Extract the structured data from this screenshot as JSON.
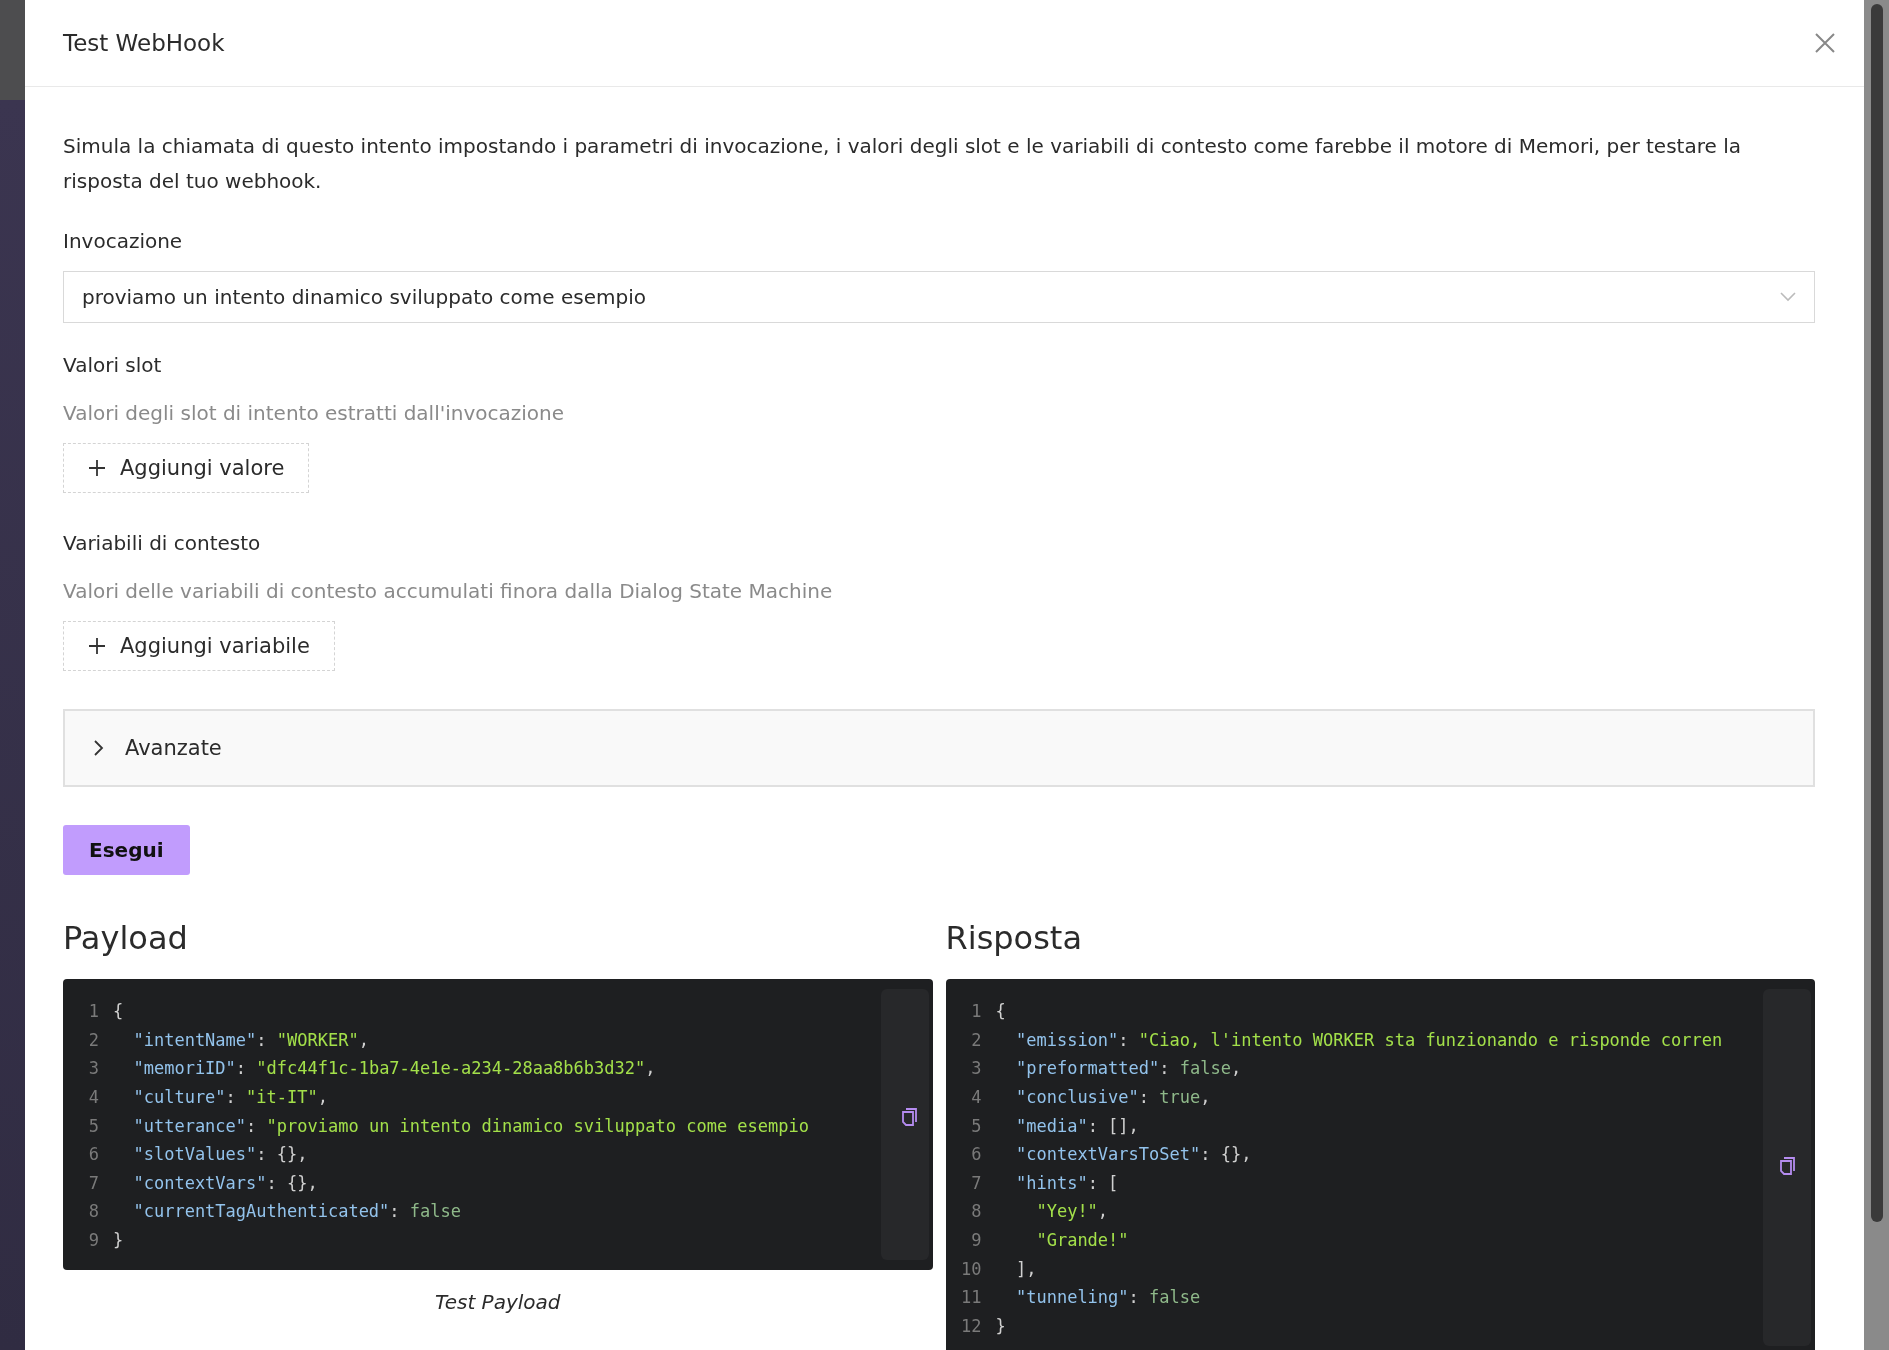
{
  "dialog": {
    "title": "Test WebHook",
    "description": "Simula la chiamata di questo intento impostando i parametri di invocazione, i valori degli slot e le variabili di contesto come farebbe il motore di Memori, per testare la risposta del tuo webhook.",
    "invocation": {
      "label": "Invocazione",
      "value": "proviamo un intento dinamico sviluppato come esempio"
    },
    "slot_values": {
      "label": "Valori slot",
      "hint": "Valori degli slot di intento estratti dall'invocazione",
      "add_button": "Aggiungi valore"
    },
    "context_variables": {
      "label": "Variabili di contesto",
      "hint": "Valori delle variabili di contesto accumulati finora dalla Dialog State Machine",
      "add_button": "Aggiungi variabile"
    },
    "advanced": {
      "label": "Avanzate",
      "expanded": false
    },
    "run_button": "Esegui",
    "payload": {
      "title": "Payload",
      "caption": "Test Payload",
      "lines": [
        {
          "number": "1",
          "kind": "root",
          "tokens": [
            {
              "kind": "punct",
              "text": "{"
            }
          ]
        },
        {
          "number": "2",
          "kind": "member",
          "tokens": [
            {
              "kind": "key",
              "text": "\"intentName\""
            },
            {
              "kind": "punct",
              "text": ": "
            },
            {
              "kind": "string",
              "text": "\"WORKER\""
            },
            {
              "kind": "punct",
              "text": ","
            }
          ]
        },
        {
          "number": "3",
          "kind": "member",
          "tokens": [
            {
              "kind": "key",
              "text": "\"memoriID\""
            },
            {
              "kind": "punct",
              "text": ": "
            },
            {
              "kind": "string",
              "text": "\"dfc44f1c-1ba7-4e1e-a234-28aa8b6b3d32\""
            },
            {
              "kind": "punct",
              "text": ","
            }
          ]
        },
        {
          "number": "4",
          "kind": "member",
          "tokens": [
            {
              "kind": "key",
              "text": "\"culture\""
            },
            {
              "kind": "punct",
              "text": ": "
            },
            {
              "kind": "string",
              "text": "\"it-IT\""
            },
            {
              "kind": "punct",
              "text": ","
            }
          ]
        },
        {
          "number": "5",
          "kind": "member",
          "tokens": [
            {
              "kind": "key",
              "text": "\"utterance\""
            },
            {
              "kind": "punct",
              "text": ": "
            },
            {
              "kind": "string",
              "text": "\"proviamo un intento dinamico sviluppato come esempio"
            }
          ]
        },
        {
          "number": "6",
          "kind": "member",
          "tokens": [
            {
              "kind": "key",
              "text": "\"slotValues\""
            },
            {
              "kind": "punct",
              "text": ": {},"
            }
          ]
        },
        {
          "number": "7",
          "kind": "member",
          "tokens": [
            {
              "kind": "key",
              "text": "\"contextVars\""
            },
            {
              "kind": "punct",
              "text": ": {},"
            }
          ]
        },
        {
          "number": "8",
          "kind": "member",
          "tokens": [
            {
              "kind": "key",
              "text": "\"currentTagAuthenticated\""
            },
            {
              "kind": "punct",
              "text": ": "
            },
            {
              "kind": "literal",
              "text": "false"
            }
          ]
        },
        {
          "number": "9",
          "kind": "root",
          "tokens": [
            {
              "kind": "punct",
              "text": "}"
            }
          ]
        }
      ]
    },
    "response": {
      "title": "Risposta",
      "lines": [
        {
          "number": "1",
          "kind": "root",
          "tokens": [
            {
              "kind": "punct",
              "text": "{"
            }
          ]
        },
        {
          "number": "2",
          "kind": "member",
          "tokens": [
            {
              "kind": "key",
              "text": "\"emission\""
            },
            {
              "kind": "punct",
              "text": ": "
            },
            {
              "kind": "string",
              "text": "\"Ciao, l'intento WORKER sta funzionando e risponde corren"
            }
          ]
        },
        {
          "number": "3",
          "kind": "member",
          "tokens": [
            {
              "kind": "key",
              "text": "\"preformatted\""
            },
            {
              "kind": "punct",
              "text": ": "
            },
            {
              "kind": "literal",
              "text": "false"
            },
            {
              "kind": "punct",
              "text": ","
            }
          ]
        },
        {
          "number": "4",
          "kind": "member",
          "tokens": [
            {
              "kind": "key",
              "text": "\"conclusive\""
            },
            {
              "kind": "punct",
              "text": ": "
            },
            {
              "kind": "literal",
              "text": "true"
            },
            {
              "kind": "punct",
              "text": ","
            }
          ]
        },
        {
          "number": "5",
          "kind": "member",
          "tokens": [
            {
              "kind": "key",
              "text": "\"media\""
            },
            {
              "kind": "punct",
              "text": ": [],"
            }
          ]
        },
        {
          "number": "6",
          "kind": "member",
          "tokens": [
            {
              "kind": "key",
              "text": "\"contextVarsToSet\""
            },
            {
              "kind": "punct",
              "text": ": {},"
            }
          ]
        },
        {
          "number": "7",
          "kind": "member",
          "tokens": [
            {
              "kind": "key",
              "text": "\"hints\""
            },
            {
              "kind": "punct",
              "text": ": ["
            }
          ]
        },
        {
          "number": "8",
          "kind": "item",
          "tokens": [
            {
              "kind": "string",
              "text": "\"Yey!\""
            },
            {
              "kind": "punct",
              "text": ","
            }
          ]
        },
        {
          "number": "9",
          "kind": "item",
          "tokens": [
            {
              "kind": "string",
              "text": "\"Grande!\""
            }
          ]
        },
        {
          "number": "10",
          "kind": "member",
          "tokens": [
            {
              "kind": "punct",
              "text": "],"
            }
          ]
        },
        {
          "number": "11",
          "kind": "member",
          "tokens": [
            {
              "kind": "key",
              "text": "\"tunneling\""
            },
            {
              "kind": "punct",
              "text": ": "
            },
            {
              "kind": "literal",
              "text": "false"
            }
          ]
        },
        {
          "number": "12",
          "kind": "root",
          "tokens": [
            {
              "kind": "punct",
              "text": "}"
            }
          ]
        }
      ]
    }
  }
}
